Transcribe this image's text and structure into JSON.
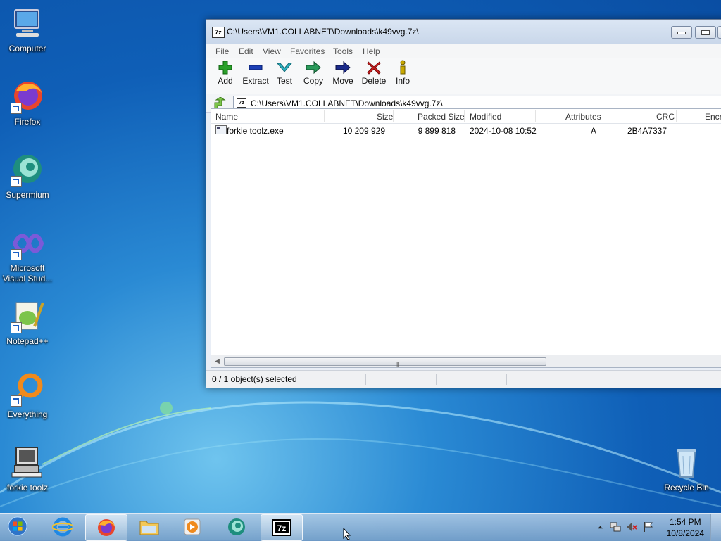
{
  "desktop": {
    "icons": [
      {
        "label": "Computer"
      },
      {
        "label": "Firefox"
      },
      {
        "label": "Supermium"
      },
      {
        "label": "Microsoft Visual Stud..."
      },
      {
        "label": "Notepad++"
      },
      {
        "label": "Everything"
      },
      {
        "label": "forkie toolz"
      },
      {
        "label": "Recycle Bin"
      }
    ]
  },
  "window": {
    "title": "C:\\Users\\VM1.COLLABNET\\Downloads\\k49vvg.7z\\",
    "app_icon_text": "7z",
    "menu": [
      "File",
      "Edit",
      "View",
      "Favorites",
      "Tools",
      "Help"
    ],
    "toolbar": [
      {
        "label": "Add",
        "icon": "plus-icon",
        "color": "#2aa02a"
      },
      {
        "label": "Extract",
        "icon": "minus-icon",
        "color": "#1c3fb5"
      },
      {
        "label": "Test",
        "icon": "check-icon",
        "color": "#2bb0c0"
      },
      {
        "label": "Copy",
        "icon": "copy-arrow-icon",
        "color": "#2a9a5a"
      },
      {
        "label": "Move",
        "icon": "move-arrow-icon",
        "color": "#1a2a8a"
      },
      {
        "label": "Delete",
        "icon": "delete-x-icon",
        "color": "#d02020"
      },
      {
        "label": "Info",
        "icon": "info-icon",
        "color": "#c8a800"
      }
    ],
    "address": "C:\\Users\\VM1.COLLABNET\\Downloads\\k49vvg.7z\\",
    "columns": [
      "Name",
      "Size",
      "Packed Size",
      "Modified",
      "Attributes",
      "CRC",
      "Encr"
    ],
    "rows": [
      {
        "name": "forkie toolz.exe",
        "size": "10 209 929",
        "packed": "9 899 818",
        "modified": "2024-10-08 10:52",
        "attributes": "A",
        "crc": "2B4A7337"
      }
    ],
    "status": "0 / 1 object(s) selected"
  },
  "taskbar": {
    "time": "1:54 PM",
    "date": "10/8/2024",
    "app_icon_text": "7z"
  }
}
